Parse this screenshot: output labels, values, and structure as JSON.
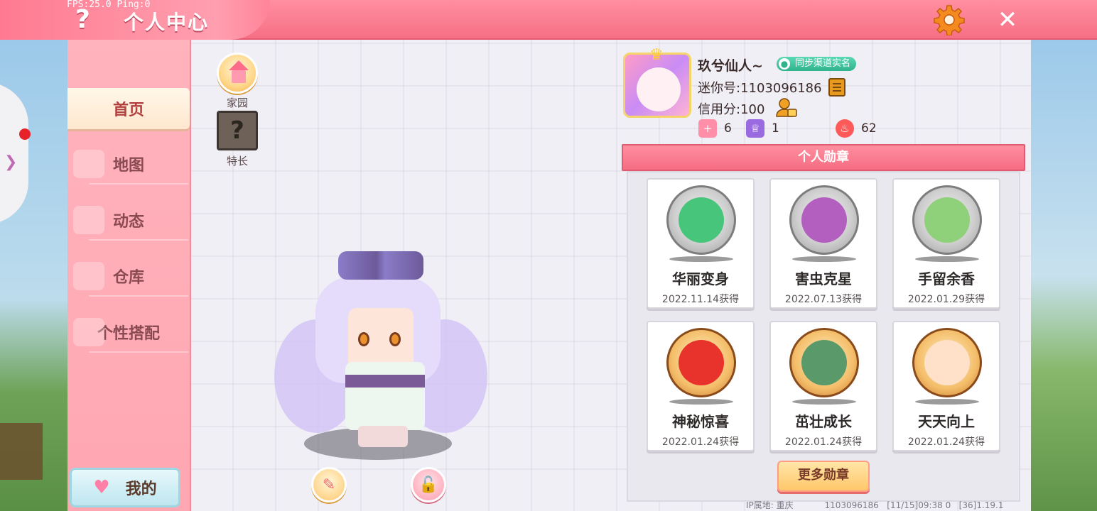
{
  "header": {
    "fps": "FPS:25.0 Ping:0",
    "title": "个人中心",
    "help_icon": "?",
    "close_icon": "✕"
  },
  "sidebar": {
    "items": [
      {
        "label": "首页",
        "active": true
      },
      {
        "label": "地图",
        "active": false
      },
      {
        "label": "动态",
        "active": false
      },
      {
        "label": "仓库",
        "active": false
      },
      {
        "label": "个性搭配",
        "active": false
      }
    ],
    "my_button": "我的"
  },
  "main": {
    "home_label": "家园",
    "specialty_label": "特长",
    "specialty_icon": "?"
  },
  "profile": {
    "name": "玖兮仙人~",
    "sync_badge": "同步渠道实名",
    "mini_id": "迷你号:1103096186",
    "credit": "信用分:100",
    "stats": [
      {
        "icon": "flag-icon",
        "value": "6",
        "color": "#ff8fa8"
      },
      {
        "icon": "trophy-icon",
        "value": "1",
        "color": "#9a6ae0"
      },
      {
        "icon": "flame-icon",
        "value": "62",
        "color": "#ff5a5a"
      }
    ]
  },
  "badges": {
    "header": "个人勋章",
    "items": [
      {
        "name": "华丽变身",
        "date": "2022.11.14获得",
        "tier": "silver",
        "color": "#47c57a"
      },
      {
        "name": "害虫克星",
        "date": "2022.07.13获得",
        "tier": "silver",
        "color": "#b35fc0"
      },
      {
        "name": "手留余香",
        "date": "2022.01.29获得",
        "tier": "silver",
        "color": "#8fd07a"
      },
      {
        "name": "神秘惊喜",
        "date": "2022.01.24获得",
        "tier": "gold",
        "color": "#e8332c"
      },
      {
        "name": "茁壮成长",
        "date": "2022.01.24获得",
        "tier": "gold",
        "color": "#5a9a6a"
      },
      {
        "name": "天天向上",
        "date": "2022.01.24获得",
        "tier": "gold",
        "color": "#ffe0c8"
      }
    ],
    "more_button": "更多勋章"
  },
  "footer": {
    "ip": "IP属地: 重庆",
    "info": "1103096186   [11/15]09:38 0   [36]1.19.1"
  }
}
